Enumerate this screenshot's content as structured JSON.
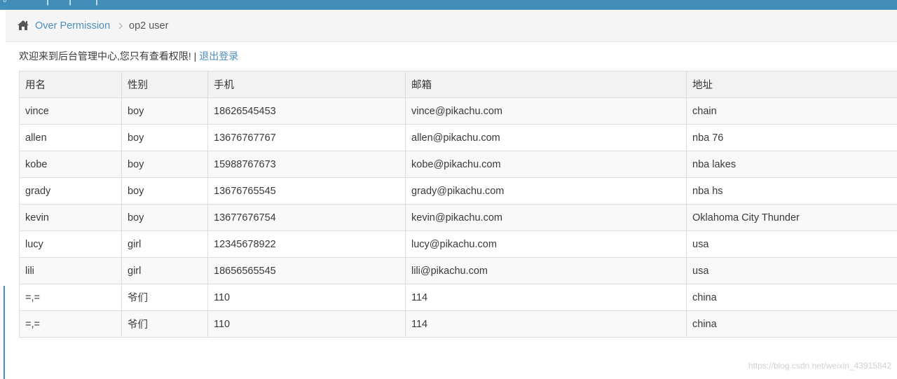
{
  "breadcrumb": {
    "home_icon": "home-icon",
    "parent_label": "Over Permission",
    "separator_icon": "chevron-right-icon",
    "current_label": "op2 user"
  },
  "welcome": {
    "message": "欢迎来到后台管理中心,您只有查看权限!",
    "divider": " | ",
    "logout_label": "退出登录"
  },
  "table": {
    "headers": [
      "用名",
      "性别",
      "手机",
      "邮箱",
      "地址"
    ],
    "rows": [
      [
        "vince",
        "boy",
        "18626545453",
        "vince@pikachu.com",
        "chain"
      ],
      [
        "allen",
        "boy",
        "13676767767",
        "allen@pikachu.com",
        "nba 76"
      ],
      [
        "kobe",
        "boy",
        "15988767673",
        "kobe@pikachu.com",
        "nba lakes"
      ],
      [
        "grady",
        "boy",
        "13676765545",
        "grady@pikachu.com",
        "nba hs"
      ],
      [
        "kevin",
        "boy",
        "13677676754",
        "kevin@pikachu.com",
        "Oklahoma City Thunder"
      ],
      [
        "lucy",
        "girl",
        "12345678922",
        "lucy@pikachu.com",
        "usa"
      ],
      [
        "lili",
        "girl",
        "18656565545",
        "lili@pikachu.com",
        "usa"
      ],
      [
        "=,=",
        "爷们",
        "110",
        "114",
        "china"
      ],
      [
        "=,=",
        "爷们",
        "110",
        "114",
        "china"
      ]
    ]
  },
  "watermark": "https://blog.csdn.net/weixin_43915842",
  "colors": {
    "topbar": "#438eb9",
    "link": "#4c8fbd",
    "breadcrumb_bg": "#f5f5f5",
    "header_bg": "#f2f2f2",
    "stripe_bg": "#f9f9f9",
    "border": "#dddddd"
  }
}
